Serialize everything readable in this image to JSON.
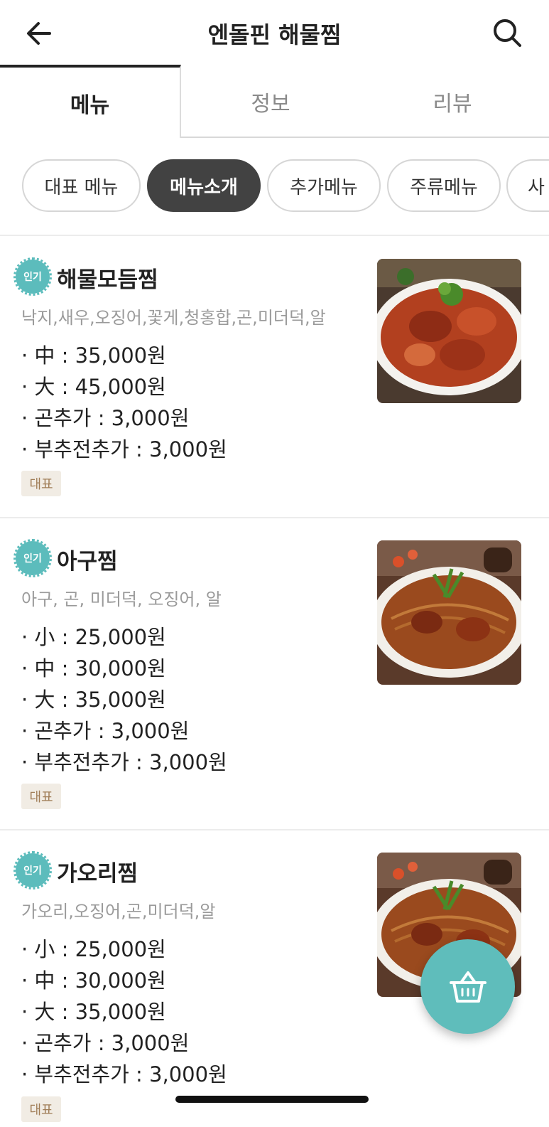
{
  "header": {
    "title": "엔돌핀 해물찜",
    "back_icon": "arrow-left-icon",
    "search_icon": "search-icon"
  },
  "tabs": [
    {
      "label": "메뉴",
      "active": true
    },
    {
      "label": "정보",
      "active": false
    },
    {
      "label": "리뷰",
      "active": false
    }
  ],
  "categories": [
    {
      "label": "대표 메뉴",
      "active": false
    },
    {
      "label": "메뉴소개",
      "active": true
    },
    {
      "label": "추가메뉴",
      "active": false
    },
    {
      "label": "주류메뉴",
      "active": false
    },
    {
      "label": "사",
      "active": false
    }
  ],
  "menu_items": [
    {
      "badge": "인기",
      "name": "해물모듬찜",
      "description": "낙지,새우,오징어,꽃게,청홍합,곤,미더덕,알",
      "prices": [
        "· 中 : 35,000원",
        "· 大 : 45,000원",
        "· 곤추가 : 3,000원",
        "· 부추전추가 : 3,000원"
      ],
      "tag": "대표"
    },
    {
      "badge": "인기",
      "name": "아구찜",
      "description": "아구, 곤, 미더덕, 오징어, 알",
      "prices": [
        "· 小 : 25,000원",
        "· 中 : 30,000원",
        "· 大 : 35,000원",
        "· 곤추가 : 3,000원",
        "· 부추전추가 : 3,000원"
      ],
      "tag": "대표"
    },
    {
      "badge": "인기",
      "name": "가오리찜",
      "description": "가오리,오징어,곤,미더덕,알",
      "prices": [
        "· 小 : 25,000원",
        "· 中 : 30,000원",
        "· 大 : 35,000원",
        "· 곤추가 : 3,000원",
        "· 부추전추가 : 3,000원"
      ],
      "tag": "대표"
    }
  ],
  "cart_icon": "shopping-basket-icon",
  "colors": {
    "accent": "#5fbdbb",
    "chip_active": "#424242",
    "tag_bg": "#f1ece4",
    "tag_text": "#a07d57"
  }
}
